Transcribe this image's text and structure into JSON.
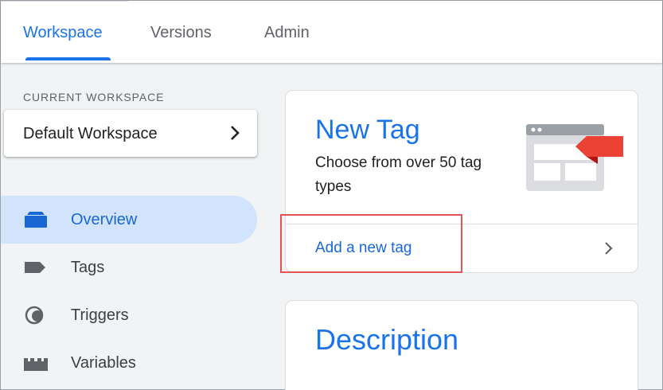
{
  "header": {
    "tabs": [
      {
        "label": "Workspace",
        "active": true
      },
      {
        "label": "Versions",
        "active": false
      },
      {
        "label": "Admin",
        "active": false
      }
    ]
  },
  "sidebar": {
    "workspace_label": "CURRENT WORKSPACE",
    "workspace_name": "Default Workspace",
    "items": [
      {
        "label": "Overview",
        "icon": "overview-icon",
        "active": true
      },
      {
        "label": "Tags",
        "icon": "tag-icon",
        "active": false
      },
      {
        "label": "Triggers",
        "icon": "trigger-icon",
        "active": false
      },
      {
        "label": "Variables",
        "icon": "variables-icon",
        "active": false
      }
    ]
  },
  "main": {
    "new_tag_card": {
      "title": "New Tag",
      "description": "Choose from over 50 tag types",
      "link": "Add a new tag",
      "illustration": "tag-illustration-icon"
    },
    "description_card": {
      "title": "Description"
    }
  },
  "colors": {
    "accent": "#1a73e8",
    "active_nav_bg": "#d2e3fc",
    "highlight": "#e05656",
    "tag_red": "#ea4335"
  }
}
